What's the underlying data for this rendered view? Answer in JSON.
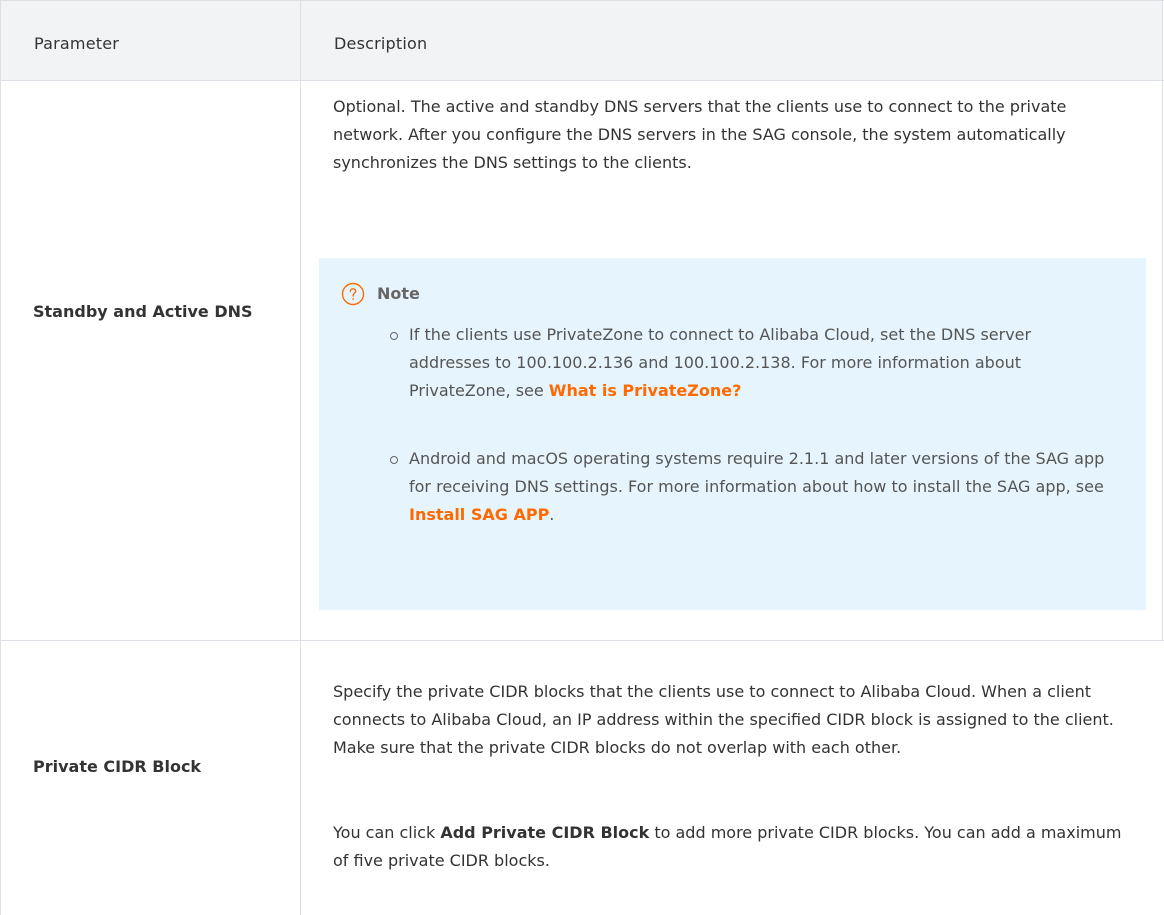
{
  "table": {
    "headers": [
      "Parameter",
      "Description"
    ],
    "rows": [
      {
        "param": "Standby and Active DNS",
        "desc": "Optional. The active and standby DNS servers that the clients use to connect to the private network. After you configure the DNS servers in the SAG console, the system automatically synchronizes the DNS settings to the clients.",
        "note": {
          "title": "Note",
          "icon": "question-circle-icon",
          "items": [
            {
              "text": "If the clients use PrivateZone to connect to Alibaba Cloud, set the DNS server addresses to 100.100.2.136 and 100.100.2.138. For more information about PrivateZone, see ",
              "link": "What is PrivateZone?",
              "suffix": ""
            },
            {
              "text": "Android and macOS operating systems require 2.1.1 and later versions of the SAG app for receiving DNS settings. For more information about how to install the SAG app, see ",
              "link": "Install SAG APP",
              "suffix": "."
            }
          ]
        }
      },
      {
        "param": "Private CIDR Block",
        "desc": "Specify the private CIDR blocks that the clients use to connect to Alibaba Cloud. When a client connects to Alibaba Cloud, an IP address within the specified CIDR block is assigned to the client. Make sure that the private CIDR blocks do not overlap with each other.",
        "desc2_pre": "You can click ",
        "desc2_bold": "Add Private CIDR Block",
        "desc2_post": " to add more private CIDR blocks. You can add a maximum of five private CIDR blocks."
      }
    ]
  },
  "colors": {
    "link": "#ff6a00",
    "note_bg": "#e6f5fd",
    "header_bg": "#f2f3f5",
    "border": "#dcdfe6"
  }
}
